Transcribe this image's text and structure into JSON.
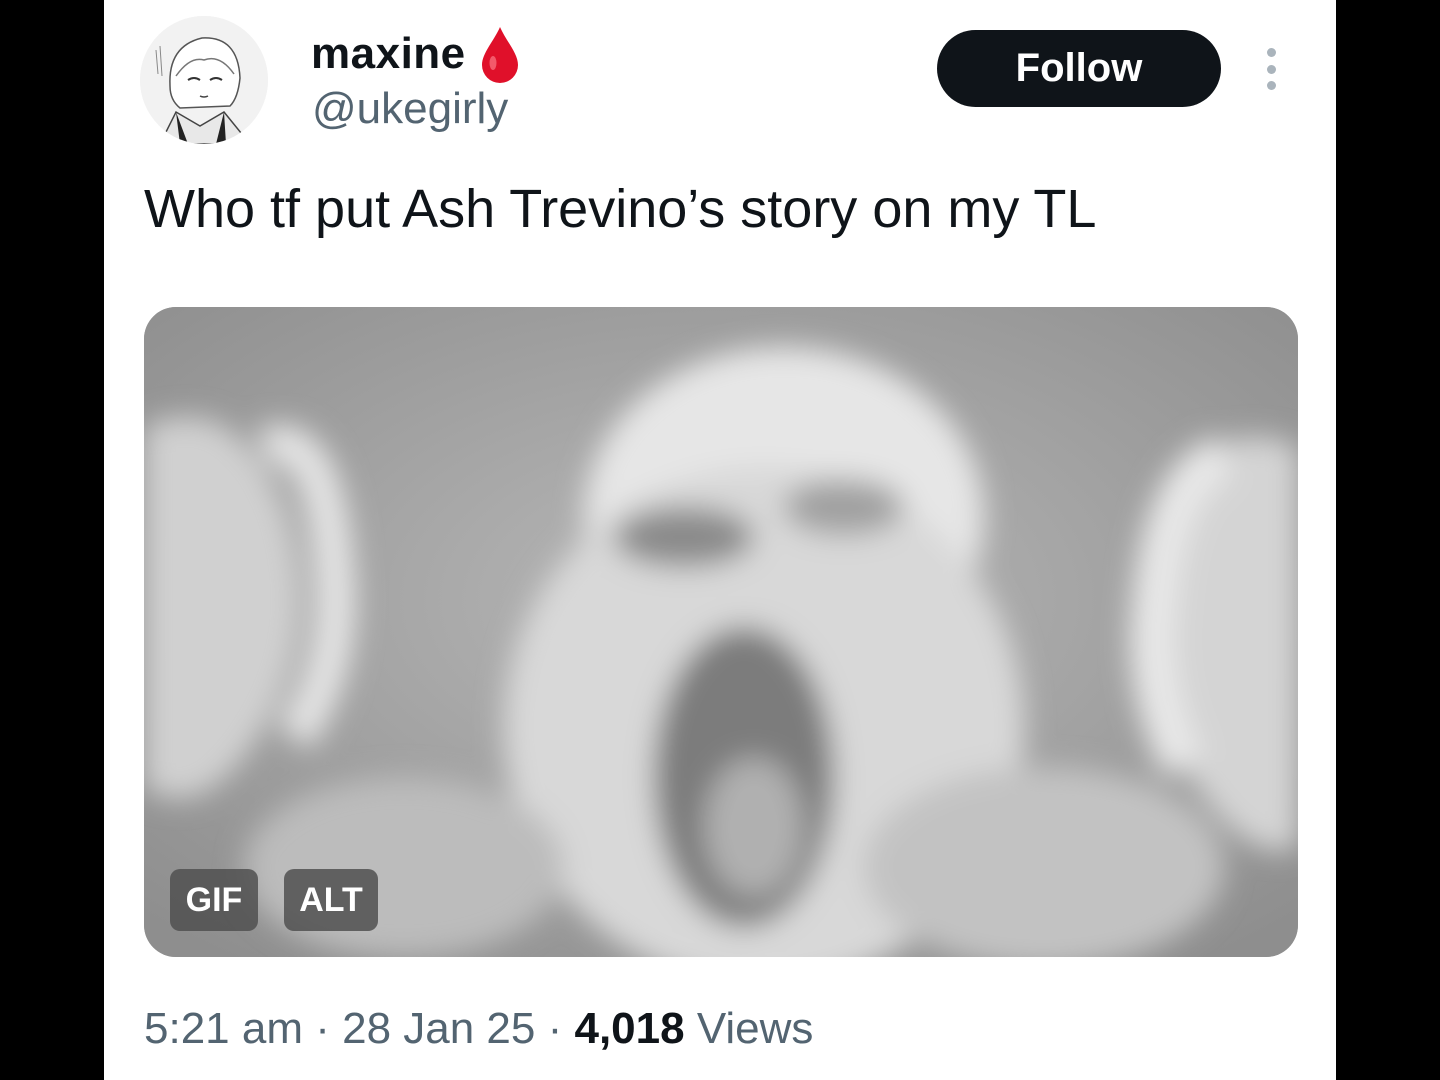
{
  "author": {
    "display_name": "maxine",
    "handle": "@ukegirly",
    "badge_icon": "blood-drop-icon",
    "avatar_desc": "manga-avatar"
  },
  "actions": {
    "follow_label": "Follow",
    "more_icon": "more-vertical-icon"
  },
  "tweet": {
    "text": "Who tf put Ash Trevino’s story on my TL"
  },
  "media": {
    "type": "gif",
    "gif_badge": "GIF",
    "alt_badge": "ALT"
  },
  "meta": {
    "time": "5:21 am",
    "sep1": " · ",
    "date": "28 Jan 25",
    "sep2": " · ",
    "views_count": "4,018",
    "views_label": " Views"
  },
  "colors": {
    "text_primary": "#0f1419",
    "text_secondary": "#536471",
    "follow_bg": "#0f1419",
    "drop_red": "#e0102a",
    "background": "#ffffff",
    "letterbox": "#000000"
  }
}
